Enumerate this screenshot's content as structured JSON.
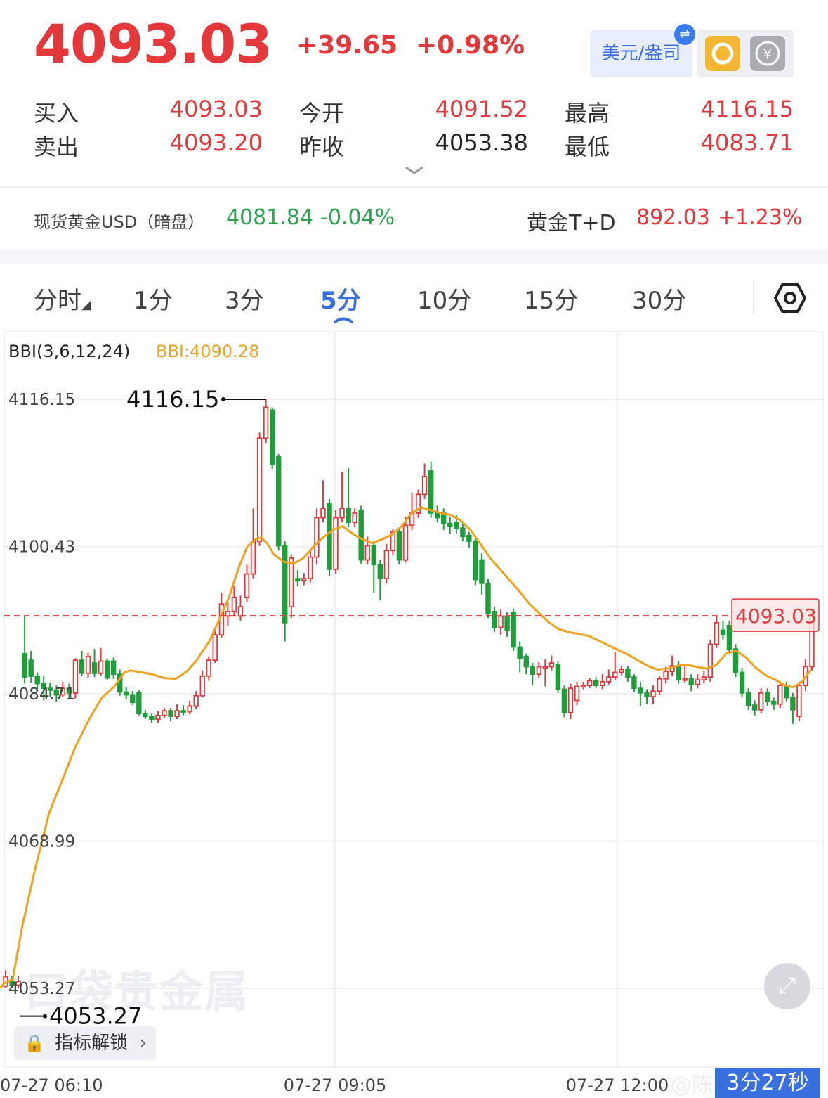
{
  "quote": {
    "price": "4093.03",
    "change": "+39.65",
    "change_pct": "+0.98%",
    "unit_label": "美元/盎司"
  },
  "stats": [
    {
      "label": "买入",
      "value": "4093.03",
      "color": "#e5383b"
    },
    {
      "label": "卖出",
      "value": "4093.20",
      "color": "#e5383b"
    },
    {
      "label": "今开",
      "value": "4091.52",
      "color": "#e5383b"
    },
    {
      "label": "昨收",
      "value": "4053.38",
      "color": "#222222"
    },
    {
      "label": "最高",
      "value": "4116.15",
      "color": "#e5383b"
    },
    {
      "label": "最低",
      "value": "4083.71",
      "color": "#e5383b"
    }
  ],
  "related": [
    {
      "name": "现货黄金USD（暗盘）",
      "value": "4081.84",
      "pct": "-0.04%",
      "color": "#2ea44f"
    },
    {
      "name": "黄金T+D",
      "value": "892.03",
      "pct": "+1.23%",
      "color": "#e5383b"
    }
  ],
  "tabs": [
    "分时",
    "1分",
    "3分",
    "5分",
    "10分",
    "15分",
    "30分"
  ],
  "active_tab": "5分",
  "lock_label": "指标解锁",
  "watermark": "口袋贵金属",
  "weibo_credit": "@陈辰Precious",
  "timer_label": "3分27秒",
  "colors": {
    "up": "#e5383b",
    "down": "#1e9e3a",
    "bbi": "#f0a21e",
    "accent": "#3a6fe0"
  },
  "icons": [
    "swap-icon",
    "refresh-icon",
    "currency-icon",
    "chevron-down-icon",
    "settings-hexagon-icon",
    "expand-icon",
    "lock-icon",
    "chevron-right-icon"
  ],
  "chart_data": {
    "type": "candlestick",
    "indicator_label": "BBI(3,6,12,24)",
    "indicator_value": "BBI:4090.28",
    "y_ticks": [
      "4116.15",
      "4100.43",
      "4084.71",
      "4068.99",
      "4053.27"
    ],
    "ylim": [
      4053.27,
      4116.15
    ],
    "max_label": "4116.15",
    "min_label": "4053.27",
    "current_price_label": "4093.03",
    "current_price": 4093.03,
    "x_ticks": [
      "07-27 06:10",
      "07-27 09:05",
      "07-27 12:00"
    ],
    "candles": [
      [
        4053.5,
        4054.5,
        4055.2,
        4053.3
      ],
      [
        4054.0,
        4053.6,
        4054.6,
        4053.3
      ],
      [
        4053.6,
        4054.0,
        4054.6,
        4053.3
      ],
      [
        4089.0,
        4086.5,
        4093.0,
        4085.8
      ],
      [
        4088.3,
        4086.6,
        4089.3,
        4085.9
      ],
      [
        4086.6,
        4085.8,
        4087.0,
        4085.0
      ],
      [
        4085.8,
        4085.3,
        4086.6,
        4084.0
      ],
      [
        4085.3,
        4085.1,
        4085.9,
        4084.4
      ],
      [
        4085.1,
        4084.6,
        4085.6,
        4083.9
      ],
      [
        4084.6,
        4085.3,
        4086.0,
        4084.4
      ],
      [
        4085.3,
        4084.8,
        4085.8,
        4084.2
      ],
      [
        4084.8,
        4088.3,
        4088.5,
        4084.2
      ],
      [
        4088.3,
        4086.9,
        4089.3,
        4086.6
      ],
      [
        4086.9,
        4088.7,
        4089.1,
        4086.4
      ],
      [
        4088.0,
        4086.9,
        4089.5,
        4086.5
      ],
      [
        4086.9,
        4088.2,
        4089.6,
        4086.6
      ],
      [
        4088.2,
        4086.4,
        4088.5,
        4086.2
      ],
      [
        4088.2,
        4086.8,
        4088.6,
        4086.3
      ],
      [
        4086.8,
        4084.9,
        4087.3,
        4084.5
      ],
      [
        4084.9,
        4084.6,
        4085.4,
        4084.1
      ],
      [
        4084.6,
        4083.8,
        4085.0,
        4083.5
      ],
      [
        4084.8,
        4082.6,
        4085.1,
        4082.4
      ],
      [
        4082.6,
        4082.3,
        4083.0,
        4082.0
      ],
      [
        4082.3,
        4082.0,
        4082.6,
        4081.6
      ],
      [
        4082.0,
        4082.4,
        4082.9,
        4081.6
      ],
      [
        4082.4,
        4082.9,
        4083.2,
        4082.1
      ],
      [
        4082.9,
        4082.3,
        4083.2,
        4081.8
      ],
      [
        4082.3,
        4082.9,
        4083.6,
        4082.0
      ],
      [
        4082.9,
        4082.8,
        4083.5,
        4082.4
      ],
      [
        4082.8,
        4083.4,
        4084.0,
        4082.5
      ],
      [
        4083.4,
        4084.5,
        4085.0,
        4083.1
      ],
      [
        4084.5,
        4086.6,
        4087.2,
        4084.3
      ],
      [
        4086.6,
        4088.3,
        4088.7,
        4086.1
      ],
      [
        4088.3,
        4091.0,
        4091.5,
        4088.0
      ],
      [
        4091.0,
        4094.3,
        4095.5,
        4090.7
      ],
      [
        4093.0,
        4093.5,
        4094.5,
        4092.0
      ],
      [
        4093.5,
        4095.0,
        4096.2,
        4093.0
      ],
      [
        4093.0,
        4094.0,
        4095.2,
        4092.5
      ],
      [
        4095.0,
        4097.5,
        4098.5,
        4094.5
      ],
      [
        4097.5,
        4101.0,
        4104.5,
        4097.0
      ],
      [
        4101.0,
        4112.0,
        4112.6,
        4100.5
      ],
      [
        4112.0,
        4115.3,
        4116.15,
        4111.5
      ],
      [
        4115.0,
        4109.2,
        4115.3,
        4108.7
      ],
      [
        4110.0,
        4100.5,
        4110.3,
        4100.0
      ],
      [
        4100.5,
        4092.3,
        4101.0,
        4090.3
      ],
      [
        4094.0,
        4099.2,
        4099.6,
        4092.8
      ],
      [
        4097.0,
        4096.8,
        4097.9,
        4096.2
      ],
      [
        4096.8,
        4097.0,
        4097.6,
        4096.3
      ],
      [
        4097.0,
        4099.3,
        4100.1,
        4096.6
      ],
      [
        4099.3,
        4103.5,
        4104.5,
        4098.5
      ],
      [
        4103.5,
        4104.5,
        4107.5,
        4103.0
      ],
      [
        4105.0,
        4098.0,
        4105.5,
        4097.3
      ],
      [
        4098.0,
        4103.5,
        4104.3,
        4097.5
      ],
      [
        4103.5,
        4104.5,
        4108.4,
        4103.0
      ],
      [
        4104.5,
        4103.0,
        4108.8,
        4102.5
      ],
      [
        4103.0,
        4104.0,
        4104.5,
        4102.5
      ],
      [
        4104.3,
        4099.0,
        4104.8,
        4098.6
      ],
      [
        4099.0,
        4100.5,
        4101.5,
        4098.5
      ],
      [
        4100.5,
        4098.5,
        4101.0,
        4095.5
      ],
      [
        4098.5,
        4097.0,
        4099.0,
        4094.7
      ],
      [
        4097.0,
        4100.0,
        4100.7,
        4096.5
      ],
      [
        4100.0,
        4102.0,
        4102.3,
        4099.5
      ],
      [
        4102.0,
        4099.0,
        4102.5,
        4098.5
      ],
      [
        4099.0,
        4102.7,
        4103.6,
        4098.7
      ],
      [
        4102.7,
        4104.0,
        4106.2,
        4102.2
      ],
      [
        4104.0,
        4106.0,
        4106.5,
        4103.5
      ],
      [
        4106.0,
        4107.9,
        4109.3,
        4105.5
      ],
      [
        4108.5,
        4104.0,
        4109.5,
        4103.5
      ],
      [
        4104.0,
        4103.5,
        4104.8,
        4103.0
      ],
      [
        4104.0,
        4102.9,
        4104.5,
        4102.2
      ],
      [
        4102.9,
        4102.6,
        4103.6,
        4101.8
      ],
      [
        4103.0,
        4102.4,
        4103.8,
        4101.8
      ],
      [
        4102.4,
        4101.5,
        4102.9,
        4101.0
      ],
      [
        4101.6,
        4101.0,
        4102.0,
        4100.3
      ],
      [
        4101.0,
        4096.9,
        4101.5,
        4096.3
      ],
      [
        4099.0,
        4096.5,
        4099.7,
        4095.3
      ],
      [
        4096.5,
        4093.3,
        4097.0,
        4092.8
      ],
      [
        4093.5,
        4091.8,
        4094.0,
        4091.3
      ],
      [
        4091.8,
        4093.0,
        4093.7,
        4091.0
      ],
      [
        4093.0,
        4091.5,
        4093.4,
        4090.8
      ],
      [
        4093.4,
        4089.7,
        4093.8,
        4089.3
      ],
      [
        4089.7,
        4088.5,
        4090.3,
        4087.0
      ],
      [
        4088.7,
        4087.6,
        4089.0,
        4086.8
      ],
      [
        4087.6,
        4086.8,
        4088.0,
        4085.6
      ],
      [
        4086.8,
        4087.6,
        4088.1,
        4086.4
      ],
      [
        4087.6,
        4087.6,
        4088.4,
        4085.5
      ],
      [
        4087.6,
        4088.0,
        4088.8,
        4087.2
      ],
      [
        4087.8,
        4085.2,
        4088.2,
        4084.8
      ],
      [
        4085.2,
        4082.7,
        4085.6,
        4082.2
      ],
      [
        4082.7,
        4085.3,
        4085.8,
        4082.0
      ],
      [
        4084.0,
        4085.5,
        4086.0,
        4083.5
      ],
      [
        4085.5,
        4085.6,
        4086.0,
        4085.2
      ],
      [
        4085.6,
        4086.1,
        4086.4,
        4085.3
      ],
      [
        4086.1,
        4085.6,
        4086.5,
        4085.3
      ],
      [
        4085.6,
        4086.0,
        4086.8,
        4085.2
      ],
      [
        4086.0,
        4086.5,
        4087.3,
        4085.7
      ],
      [
        4086.5,
        4087.0,
        4089.2,
        4086.2
      ],
      [
        4087.0,
        4087.3,
        4087.7,
        4086.7
      ],
      [
        4087.3,
        4086.5,
        4087.7,
        4086.0
      ],
      [
        4086.5,
        4085.3,
        4086.8,
        4084.9
      ],
      [
        4085.3,
        4084.8,
        4086.0,
        4083.4
      ],
      [
        4084.8,
        4084.4,
        4085.2,
        4083.6
      ],
      [
        4084.4,
        4085.0,
        4085.6,
        4083.6
      ],
      [
        4085.0,
        4086.3,
        4086.6,
        4084.6
      ],
      [
        4086.3,
        4087.1,
        4087.6,
        4085.8
      ],
      [
        4087.1,
        4087.7,
        4088.8,
        4086.6
      ],
      [
        4087.7,
        4086.2,
        4088.2,
        4085.8
      ],
      [
        4086.2,
        4086.3,
        4087.8,
        4085.9
      ],
      [
        4086.3,
        4085.7,
        4086.8,
        4085.0
      ],
      [
        4085.7,
        4086.2,
        4086.8,
        4085.3
      ],
      [
        4086.2,
        4086.5,
        4087.2,
        4085.8
      ],
      [
        4086.5,
        4090.0,
        4090.5,
        4086.0
      ],
      [
        4090.0,
        4092.3,
        4093.0,
        4089.6
      ],
      [
        4091.5,
        4091.0,
        4092.5,
        4090.5
      ],
      [
        4092.0,
        4089.5,
        4092.5,
        4089.0
      ],
      [
        4089.5,
        4087.0,
        4090.0,
        4086.5
      ],
      [
        4087.0,
        4084.8,
        4087.5,
        4084.3
      ],
      [
        4084.8,
        4083.5,
        4085.3,
        4083.0
      ],
      [
        4083.5,
        4083.0,
        4084.0,
        4082.4
      ],
      [
        4083.0,
        4084.8,
        4085.3,
        4082.6
      ],
      [
        4084.8,
        4083.9,
        4085.3,
        4083.4
      ],
      [
        4083.9,
        4083.6,
        4084.3,
        4083.0
      ],
      [
        4083.6,
        4085.6,
        4086.0,
        4083.2
      ],
      [
        4085.6,
        4084.3,
        4086.0,
        4083.9
      ],
      [
        4084.3,
        4083.0,
        4084.8,
        4081.5
      ],
      [
        4082.3,
        4085.6,
        4086.0,
        4081.8
      ],
      [
        4085.6,
        4087.6,
        4088.4,
        4085.0
      ],
      [
        4087.6,
        4093.03,
        4093.5,
        4087.2
      ]
    ],
    "bbi": [
      [
        0,
        4053.3
      ],
      [
        6,
        4053.8
      ],
      [
        18,
        4054.2
      ],
      [
        32,
        4060
      ],
      [
        50,
        4066
      ],
      [
        70,
        4072
      ],
      [
        86,
        4075
      ],
      [
        107,
        4079
      ],
      [
        127,
        4082
      ],
      [
        145,
        4084.3
      ],
      [
        163,
        4085.5
      ],
      [
        177,
        4087
      ],
      [
        185,
        4087.2
      ],
      [
        202,
        4087.0
      ],
      [
        216,
        4086.8
      ],
      [
        234,
        4086.4
      ],
      [
        250,
        4086.3
      ],
      [
        266,
        4087.1
      ],
      [
        280,
        4088.3
      ],
      [
        298,
        4090.3
      ],
      [
        312,
        4092.6
      ],
      [
        326,
        4095.0
      ],
      [
        340,
        4098.2
      ],
      [
        352,
        4100.4
      ],
      [
        364,
        4101.2
      ],
      [
        372,
        4101.4
      ],
      [
        380,
        4100.8
      ],
      [
        390,
        4099.6
      ],
      [
        404,
        4098.8
      ],
      [
        418,
        4098.6
      ],
      [
        432,
        4099.2
      ],
      [
        446,
        4100.4
      ],
      [
        460,
        4101.4
      ],
      [
        474,
        4102.2
      ],
      [
        488,
        4102.6
      ],
      [
        502,
        4101.8
      ],
      [
        516,
        4101.2
      ],
      [
        530,
        4100.8
      ],
      [
        544,
        4101.2
      ],
      [
        558,
        4101.7
      ],
      [
        572,
        4102.6
      ],
      [
        586,
        4104.0
      ],
      [
        600,
        4104.6
      ],
      [
        614,
        4104.3
      ],
      [
        628,
        4104.0
      ],
      [
        642,
        4103.8
      ],
      [
        656,
        4103.2
      ],
      [
        670,
        4102.2
      ],
      [
        684,
        4100.7
      ],
      [
        698,
        4099.2
      ],
      [
        712,
        4098.0
      ],
      [
        726,
        4096.8
      ],
      [
        740,
        4095.6
      ],
      [
        754,
        4094.3
      ],
      [
        768,
        4093.3
      ],
      [
        782,
        4092.3
      ],
      [
        796,
        4091.6
      ],
      [
        810,
        4091.3
      ],
      [
        824,
        4091.1
      ],
      [
        838,
        4090.9
      ],
      [
        852,
        4090.4
      ],
      [
        866,
        4089.9
      ],
      [
        880,
        4089.4
      ],
      [
        894,
        4088.9
      ],
      [
        908,
        4088.3
      ],
      [
        922,
        4087.7
      ],
      [
        936,
        4087.3
      ],
      [
        950,
        4087.4
      ],
      [
        964,
        4087.7
      ],
      [
        978,
        4087.8
      ],
      [
        992,
        4087.6
      ],
      [
        1006,
        4087.4
      ],
      [
        1020,
        4087.8
      ],
      [
        1034,
        4089.0
      ],
      [
        1048,
        4089.3
      ],
      [
        1062,
        4088.6
      ],
      [
        1076,
        4087.5
      ],
      [
        1090,
        4086.7
      ],
      [
        1104,
        4086.2
      ],
      [
        1118,
        4085.6
      ],
      [
        1130,
        4085.4
      ],
      [
        1142,
        4086.0
      ],
      [
        1155,
        4087.3
      ]
    ]
  }
}
